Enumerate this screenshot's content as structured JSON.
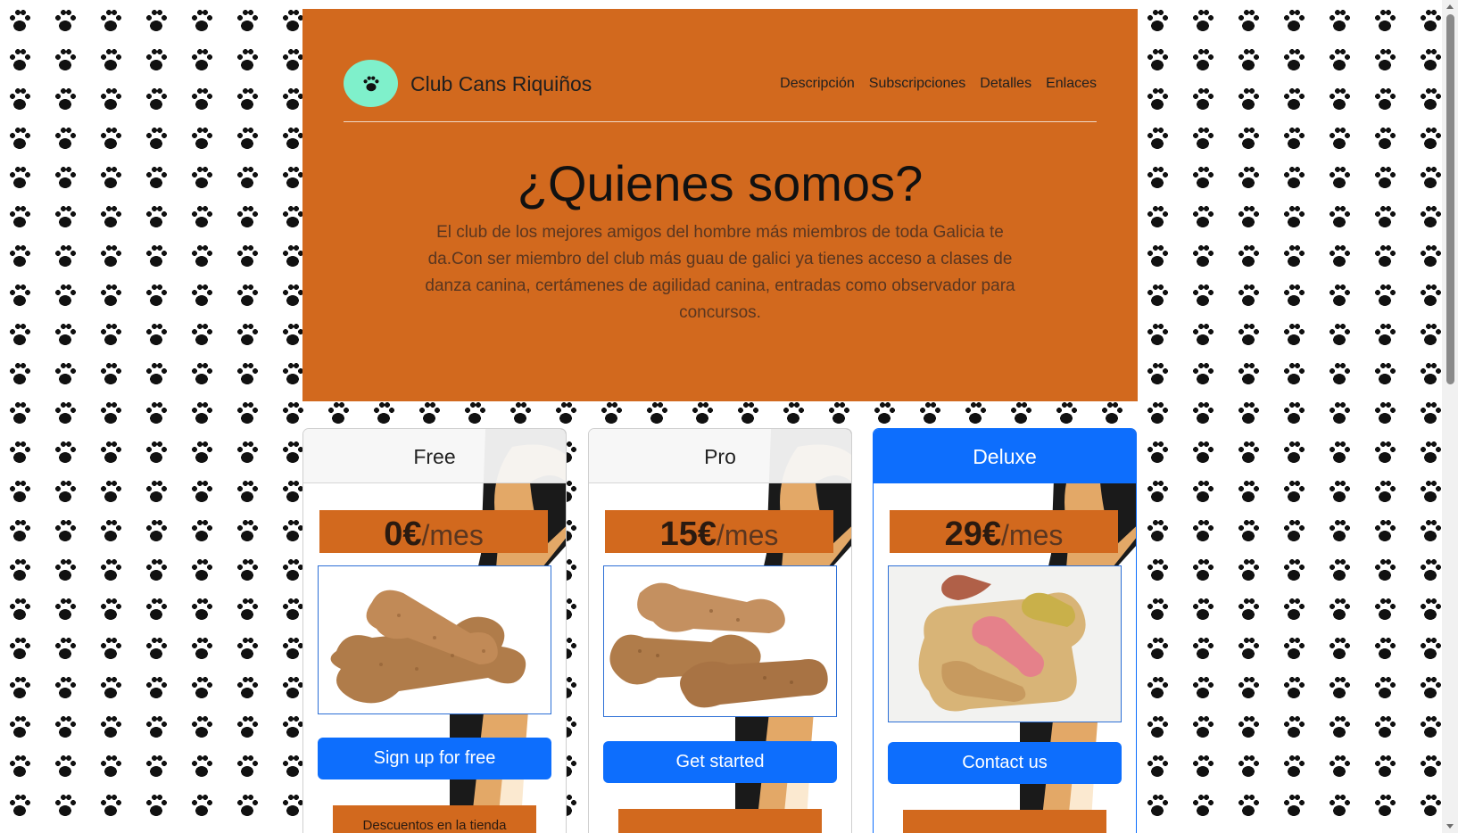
{
  "header": {
    "brand": "Club Cans Riquiños",
    "logo_icon": "paw-icon",
    "nav": [
      "Descripción",
      "Subscripciones",
      "Detalles",
      "Enlaces"
    ]
  },
  "hero": {
    "title": "¿Quienes somos?",
    "text": "El club de los mejores amigos del hombre más miembros de toda Galicia te da.Con ser miembro del club más guau de galici ya tienes acceso a clases de danza canina, certámenes de agilidad canina, entradas como observador para concursos."
  },
  "plans": [
    {
      "name": "Free",
      "amount": "0€",
      "period": "/mes",
      "image": "dog-biscuits-photo",
      "button": "Sign up for free",
      "feature": "Descuentos en la tienda"
    },
    {
      "name": "Pro",
      "amount": "15€",
      "period": "/mes",
      "image": "dog-biscuits-pile-photo",
      "button": "Get started",
      "feature": ""
    },
    {
      "name": "Deluxe",
      "amount": "29€",
      "period": "/mes",
      "image": "rawhide-bones-treats-photo",
      "button": "Contact us",
      "feature": ""
    }
  ],
  "colors": {
    "hero_bg": "#d2691e",
    "logo_bg": "#7ff0cb",
    "primary_button": "#0d6efd",
    "page_pattern": "paw-print-pattern"
  }
}
